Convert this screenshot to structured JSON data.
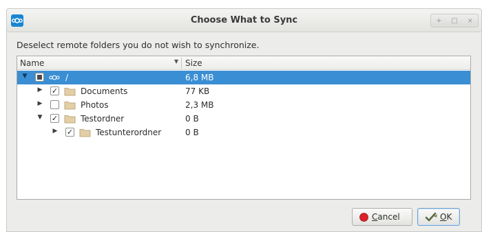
{
  "window": {
    "title": "Choose What to Sync",
    "controls": [
      "+",
      "□",
      "×"
    ]
  },
  "description": "Deselect remote folders you do not wish to synchronize.",
  "tree": {
    "columns": {
      "name": "Name",
      "size": "Size"
    },
    "rows": [
      {
        "name": "/",
        "size": "6,8 MB",
        "expanded": true,
        "checkbox": "partial",
        "selected": true,
        "icon": "cloud-icon"
      },
      {
        "name": "Documents",
        "size": "77 KB",
        "expanded": false,
        "checkbox": "checked",
        "icon": "folder-icon"
      },
      {
        "name": "Photos",
        "size": "2,3 MB",
        "expanded": false,
        "checkbox": "unchecked",
        "icon": "folder-icon"
      },
      {
        "name": "Testordner",
        "size": "0 B",
        "expanded": true,
        "checkbox": "checked",
        "icon": "folder-icon"
      },
      {
        "name": "Testunterordner",
        "size": "0 B",
        "expanded": false,
        "checkbox": "checked",
        "icon": "folder-icon"
      }
    ]
  },
  "buttons": {
    "cancel": {
      "mnemonic": "C",
      "rest": "ancel",
      "icon": "cancel-icon"
    },
    "ok": {
      "mnemonic": "O",
      "rest": "K",
      "icon": "ok-icon"
    }
  },
  "colors": {
    "selection": "#3a8ed3",
    "app_icon": "#1a86d1"
  }
}
